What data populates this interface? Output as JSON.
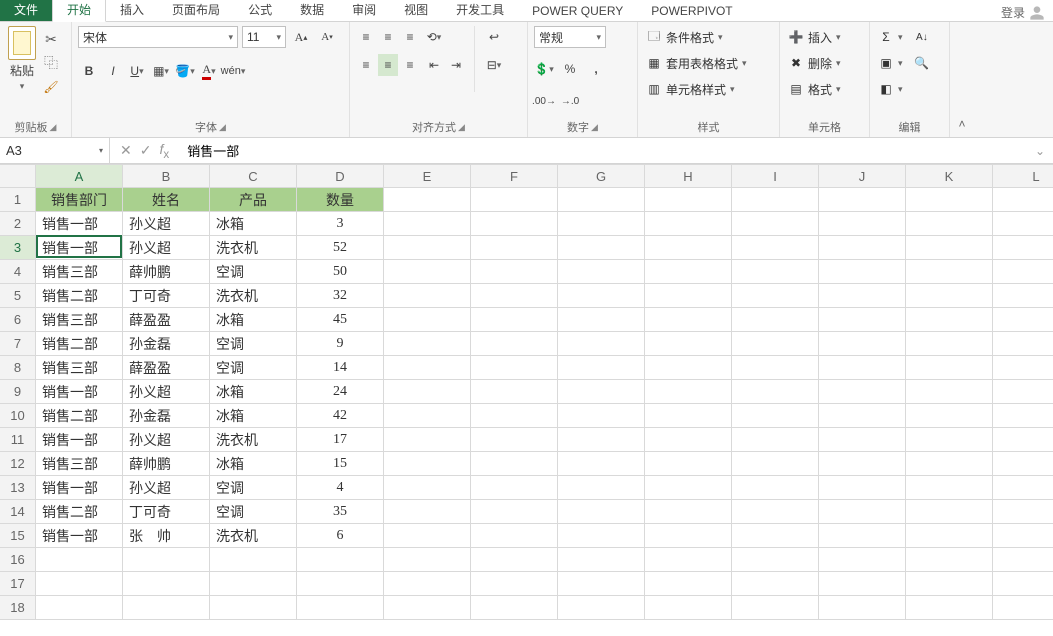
{
  "tabs": {
    "file": "文件",
    "home": "开始",
    "insert": "插入",
    "layout": "页面布局",
    "formulas": "公式",
    "data": "数据",
    "review": "审阅",
    "view": "视图",
    "dev": "开发工具",
    "pq": "POWER QUERY",
    "pp": "POWERPIVOT"
  },
  "login": "登录",
  "ribbon": {
    "clipboard": {
      "paste": "粘贴",
      "label": "剪贴板"
    },
    "font": {
      "name": "宋体",
      "size": "11",
      "label": "字体"
    },
    "align": {
      "label": "对齐方式"
    },
    "number": {
      "format": "常规",
      "label": "数字"
    },
    "styles": {
      "cond": "条件格式",
      "table": "套用表格格式",
      "cell": "单元格样式",
      "label": "样式"
    },
    "cells": {
      "insert": "插入",
      "delete": "删除",
      "format": "格式",
      "label": "单元格"
    },
    "editing": {
      "label": "编辑"
    }
  },
  "namebox": "A3",
  "formula": "销售一部",
  "columns": [
    "A",
    "B",
    "C",
    "D",
    "E",
    "F",
    "G",
    "H",
    "I",
    "J",
    "K",
    "L"
  ],
  "rowNums": 18,
  "selected": {
    "row": 3,
    "col": 0
  },
  "headers": [
    "销售部门",
    "姓名",
    "产品",
    "数量"
  ],
  "data": [
    [
      "销售一部",
      "孙义超",
      "冰箱",
      "3"
    ],
    [
      "销售一部",
      "孙义超",
      "洗衣机",
      "52"
    ],
    [
      "销售三部",
      "薛帅鹏",
      "空调",
      "50"
    ],
    [
      "销售二部",
      "丁可奇",
      "洗衣机",
      "32"
    ],
    [
      "销售三部",
      "薛盈盈",
      "冰箱",
      "45"
    ],
    [
      "销售二部",
      "孙金磊",
      "空调",
      "9"
    ],
    [
      "销售三部",
      "薛盈盈",
      "空调",
      "14"
    ],
    [
      "销售一部",
      "孙义超",
      "冰箱",
      "24"
    ],
    [
      "销售二部",
      "孙金磊",
      "冰箱",
      "42"
    ],
    [
      "销售一部",
      "孙义超",
      "洗衣机",
      "17"
    ],
    [
      "销售三部",
      "薛帅鹏",
      "冰箱",
      "15"
    ],
    [
      "销售一部",
      "孙义超",
      "空调",
      "4"
    ],
    [
      "销售二部",
      "丁可奇",
      "空调",
      "35"
    ],
    [
      "销售一部",
      "张　帅",
      "洗衣机",
      "6"
    ]
  ]
}
